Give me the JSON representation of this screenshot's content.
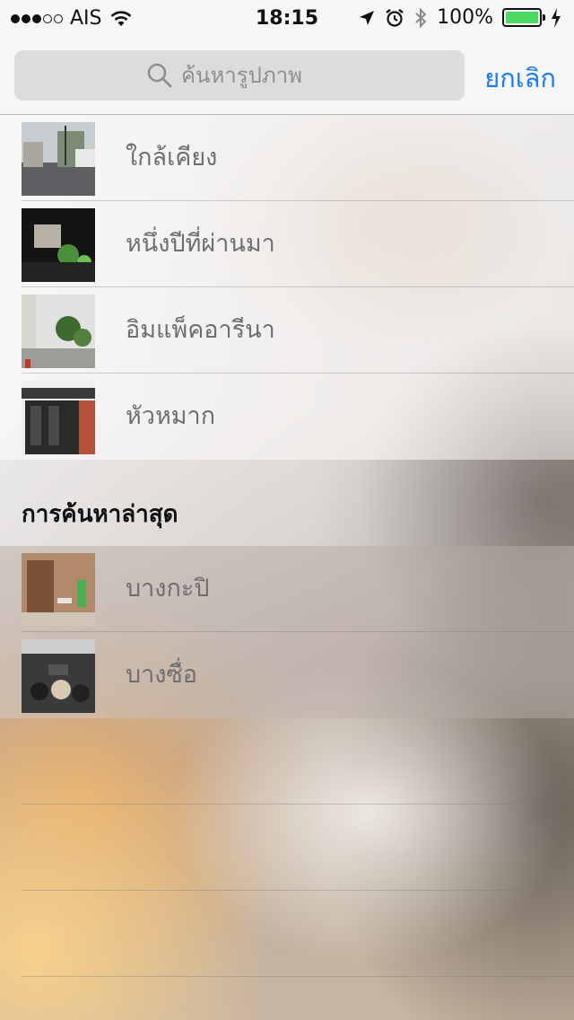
{
  "status_bar": {
    "carrier": "AIS",
    "time": "18:15",
    "battery_percent": "100%",
    "signal_bars_filled": 3,
    "signal_bars_total": 5
  },
  "search": {
    "placeholder": "ค้นหารูปภาพ",
    "value": "",
    "cancel_label": "ยกเลิก"
  },
  "suggestions": [
    {
      "label": "ใกล้เคียง"
    },
    {
      "label": "หนึ่งปีที่ผ่านมา"
    },
    {
      "label": "อิมแพ็คอารีนา"
    },
    {
      "label": "หัวหมาก"
    }
  ],
  "recent": {
    "title": "การค้นหาล่าสุด",
    "items": [
      {
        "label": "บางกะปิ"
      },
      {
        "label": "บางซื่อ"
      }
    ]
  },
  "colors": {
    "accent": "#1a7cf5",
    "battery": "#4cd964"
  }
}
